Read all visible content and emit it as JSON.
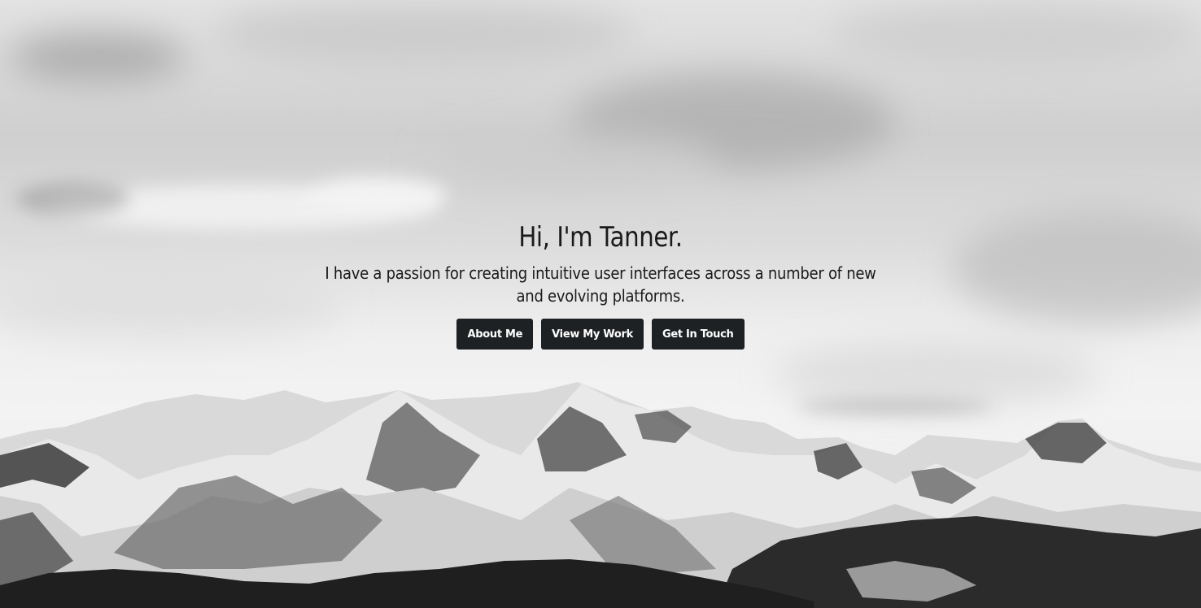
{
  "hero": {
    "headline": "Hi, I'm Tanner.",
    "tagline": "I have a passion for creating intuitive user interfaces across a number of new and evolving platforms.",
    "buttons": [
      {
        "label": "About Me"
      },
      {
        "label": "View My Work"
      },
      {
        "label": "Get In Touch"
      }
    ],
    "background_image": "mountain-range-grayscale",
    "button_color": "#1e2124"
  }
}
